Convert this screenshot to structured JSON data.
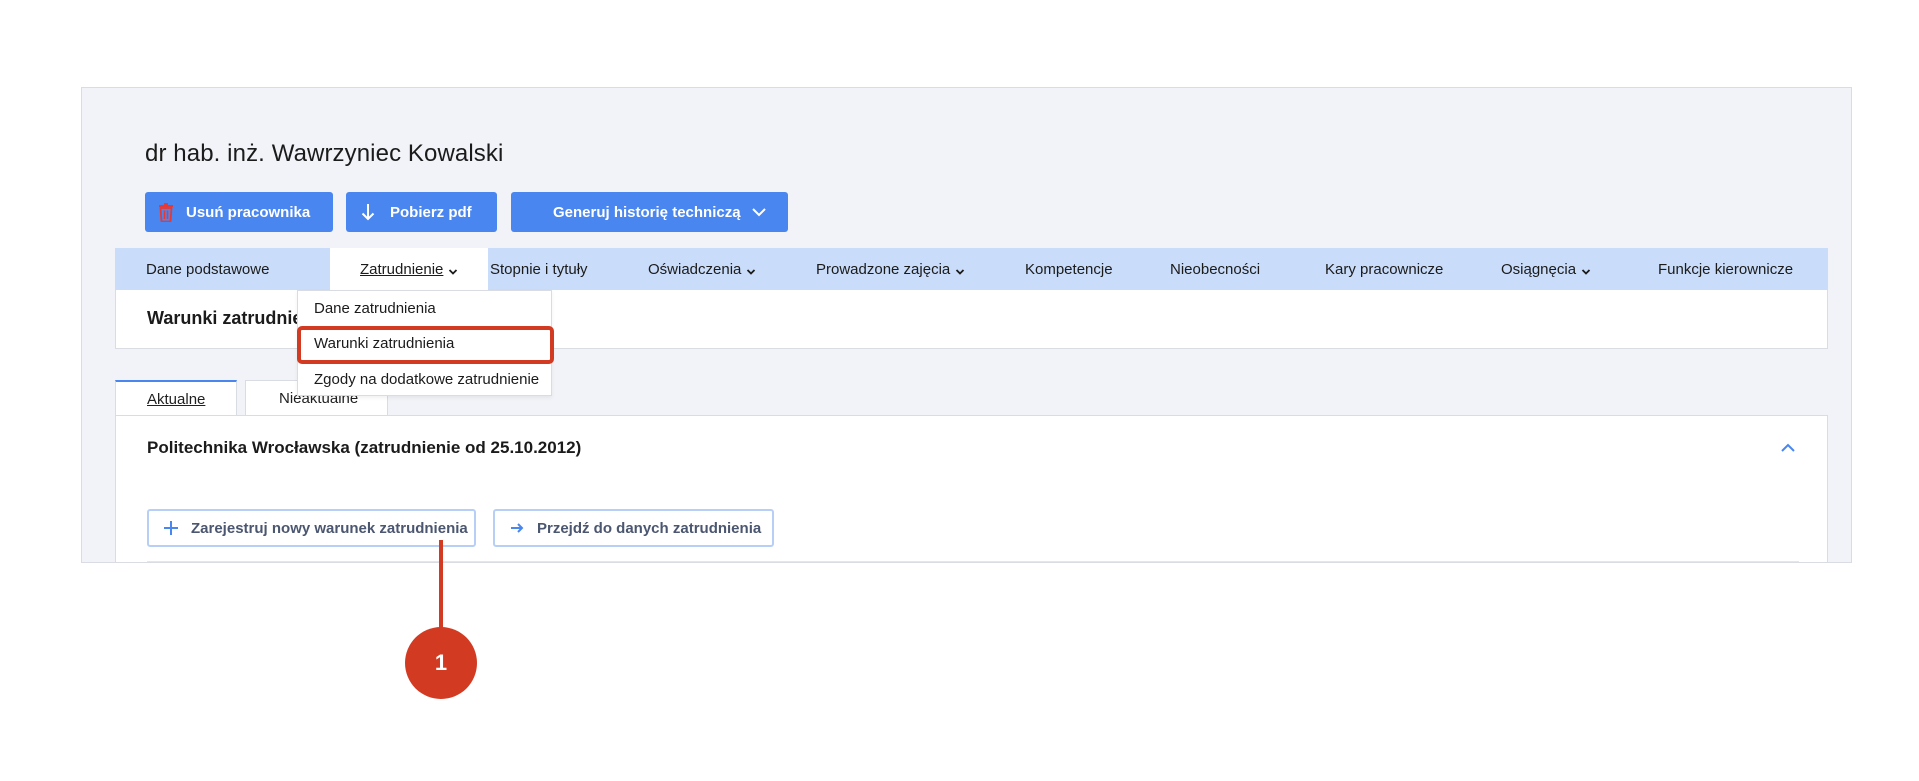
{
  "header": {
    "title": "dr hab. inż. Wawrzyniec Kowalski"
  },
  "actions": {
    "delete_label": "Usuń pracownika",
    "pdf_label": "Pobierz pdf",
    "history_label": "Generuj historię techniczą"
  },
  "nav": {
    "tabs": [
      {
        "label": "Dane podstawowe"
      },
      {
        "label": "Zatrudnienie"
      },
      {
        "label": "Stopnie i tytuły"
      },
      {
        "label": "Oświadczenia"
      },
      {
        "label": "Prowadzone zajęcia"
      },
      {
        "label": "Kompetencje"
      },
      {
        "label": "Nieobecności"
      },
      {
        "label": "Kary pracownicze"
      },
      {
        "label": "Osiągnęcia"
      },
      {
        "label": "Funkcje kierownicze"
      }
    ],
    "active": "Zatrudnienie"
  },
  "dropdown": {
    "items": [
      {
        "label": "Dane zatrudnienia"
      },
      {
        "label": "Warunki zatrudnienia"
      },
      {
        "label": "Zgody na dodatkowe zatrudnienie"
      }
    ],
    "highlighted": "Warunki zatrudnienia"
  },
  "section": {
    "title": "Warunki zatrudnienia"
  },
  "subtabs": {
    "current": "Aktualne",
    "old": "Nieaktualne"
  },
  "panel": {
    "title": "Politechnika Wrocławska (zatrudnienie od 25.10.2012)",
    "register_label": "Zarejestruj nowy warunek zatrudnienia",
    "goto_label": "Przejdź do danych zatrudnienia"
  },
  "callout": {
    "number": "1"
  },
  "colors": {
    "primary": "#4a86f0",
    "nav_bg": "#c9dcf9",
    "highlight": "#d23a22",
    "delete_icon": "#e53935"
  }
}
